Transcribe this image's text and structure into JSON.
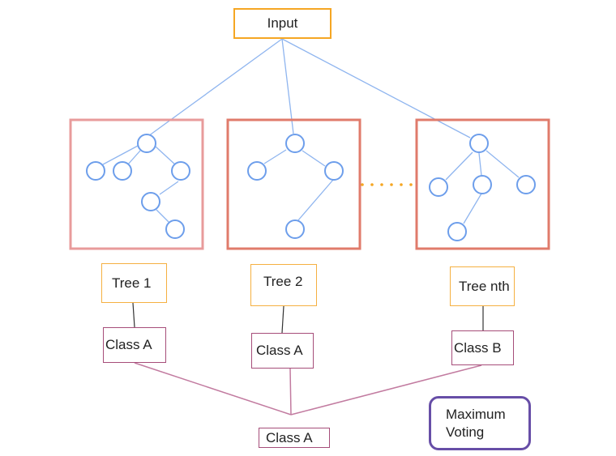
{
  "input": {
    "label": "Input"
  },
  "trees": [
    {
      "name": "Tree 1",
      "prediction": "Class A"
    },
    {
      "name": "Tree 2",
      "prediction": "Class A"
    },
    {
      "name": "Tree nth",
      "prediction": "Class B"
    }
  ],
  "final_output": {
    "label": "Class A"
  },
  "aggregation": {
    "label_line1": "Maximum",
    "label_line2": "Voting"
  },
  "colors": {
    "input_border": "#f5a623",
    "tree_label_border": "#f5b041",
    "class_border": "#a64d79",
    "tree_frame_1": "#e89b9b",
    "tree_frame_other": "#e07b6b",
    "node": "#6d9eeb",
    "edge": "#8fb5ef",
    "ellipsis": "#f5a623",
    "vote_border": "#674ea7"
  }
}
